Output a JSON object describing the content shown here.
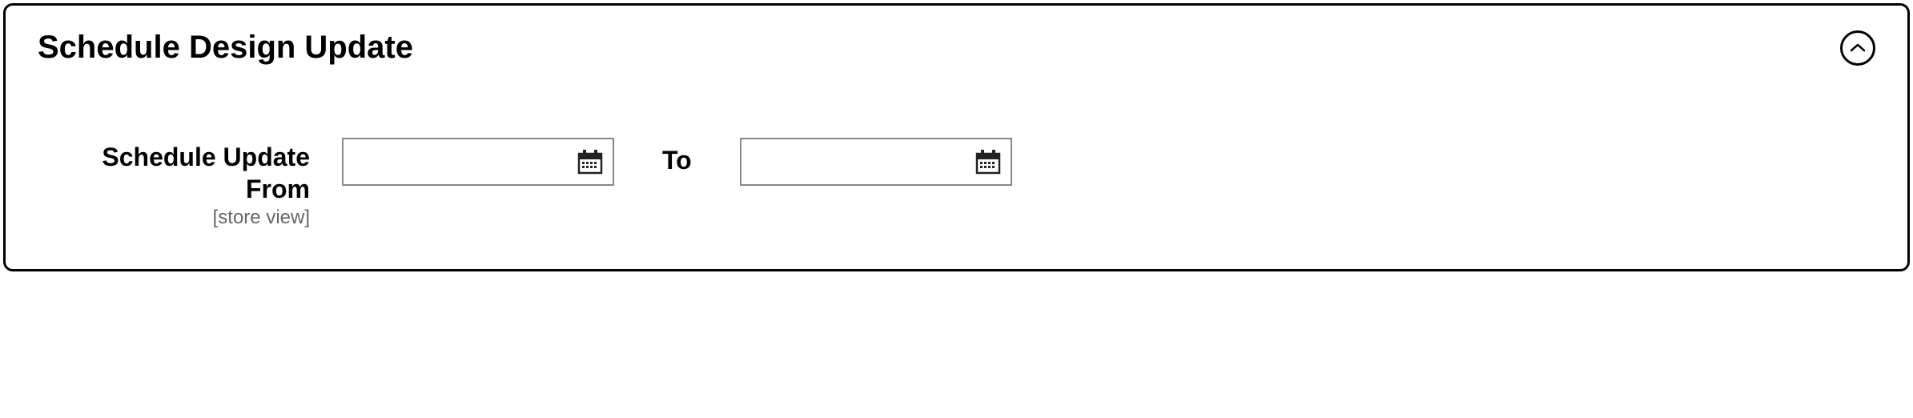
{
  "panel": {
    "title": "Schedule Design Update"
  },
  "fields": {
    "from": {
      "label": "Schedule Update From",
      "scope": "[store view]",
      "value": ""
    },
    "to": {
      "label": "To",
      "value": ""
    }
  }
}
